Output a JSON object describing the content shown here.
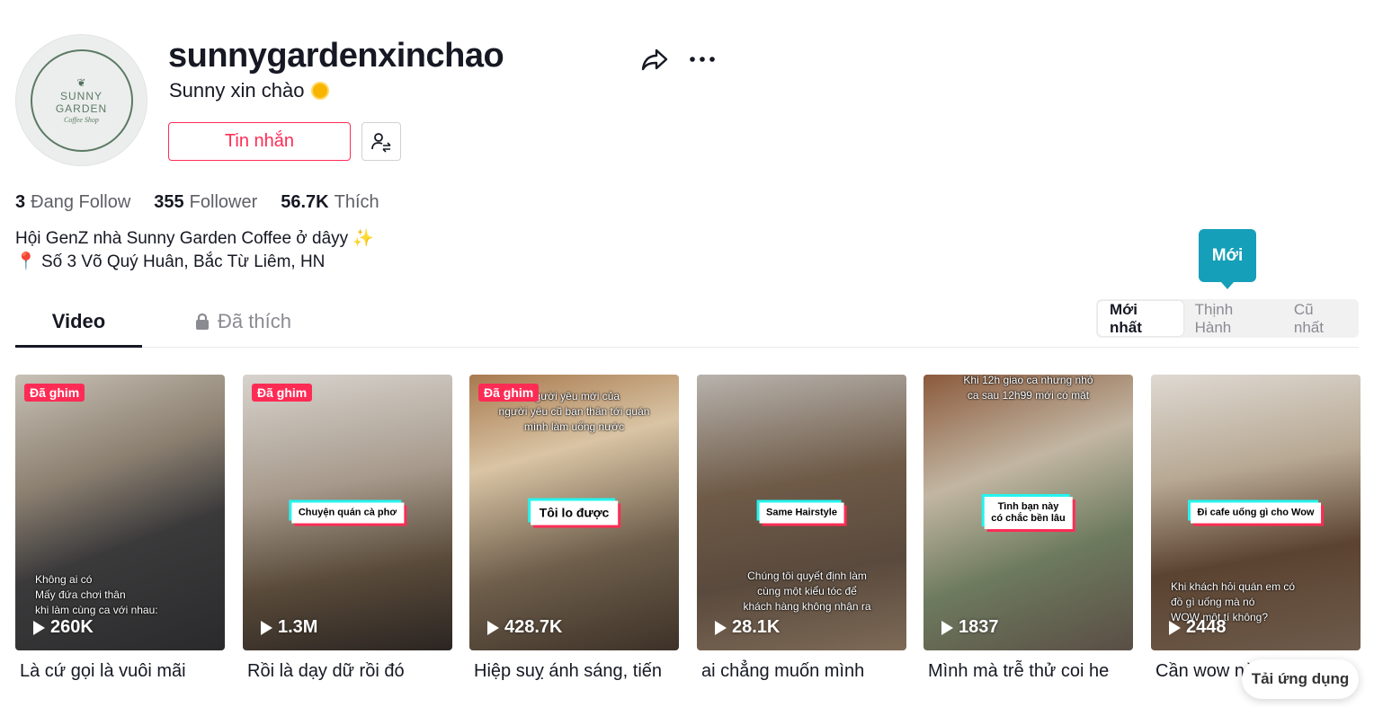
{
  "profile": {
    "avatar_text": "SUNNY GARDEN",
    "avatar_sub": "Coffee Shop",
    "username": "sunnygardenxinchao",
    "nickname": "Sunny xin chào",
    "message_label": "Tin nhắn",
    "stats": [
      {
        "value": "3",
        "label": "Đang Follow"
      },
      {
        "value": "355",
        "label": "Follower"
      },
      {
        "value": "56.7K",
        "label": "Thích"
      }
    ],
    "bio_line1": "Hội GenZ nhà Sunny Garden Coffee ở dâyy ✨",
    "bio_line2": "Số 3 Võ Quý Huân, Bắc Từ Liêm, HN"
  },
  "tabs": {
    "video": "Video",
    "liked": "Đã thích"
  },
  "sort": {
    "options": [
      "Mới nhất",
      "Thịnh Hành",
      "Cũ nhất"
    ],
    "tooltip": "Mới"
  },
  "videos": [
    {
      "pinned": "Đã ghim",
      "views": "260K",
      "title": "Là cứ gọi là vuôi mãi",
      "caption": "",
      "top_text": "",
      "bottom_text": "Không ai có\nMấy đứa chơi thân\nkhi làm cùng ca với nhau:"
    },
    {
      "pinned": "Đã ghim",
      "views": "1.3M",
      "title": "Rồi là dạy dữ rồi đó",
      "caption": "Chuyện quán cà phơ",
      "top_text": "",
      "bottom_text": ""
    },
    {
      "pinned": "Đã ghim",
      "views": "428.7K",
      "title": "Hiệp suỵ ánh sáng, tiến",
      "caption": "Tôi lo được",
      "top_text": "người yêu mới của\nngười yêu cũ bạn thân tới quán\nmình làm uống nước",
      "bottom_text": ""
    },
    {
      "pinned": "",
      "views": "28.1K",
      "title": "ai chẳng muốn mình",
      "caption": "Same Hairstyle",
      "top_text": "",
      "bottom_text": "Chúng tôi quyết định làm\ncùng một kiểu tóc để\nkhách hàng không nhận ra"
    },
    {
      "pinned": "",
      "views": "1837",
      "title": "Mình mà trễ thử coi he",
      "caption": "Tình bạn này\ncó chắc bền lâu",
      "top_text": "Khi 12h giao ca nhưng nhỏ\nca sau 12h99 mới có mặt",
      "bottom_text": ""
    },
    {
      "pinned": "",
      "views": "2448",
      "title": "Cần wow nè",
      "caption": "Đi cafe uống gì cho Wow",
      "top_text": "",
      "bottom_text": "Khi khách hỏi quán em có\nđồ gì uống mà nó\nWOW một tí không?"
    }
  ],
  "download_app": "Tải ứng dụng"
}
